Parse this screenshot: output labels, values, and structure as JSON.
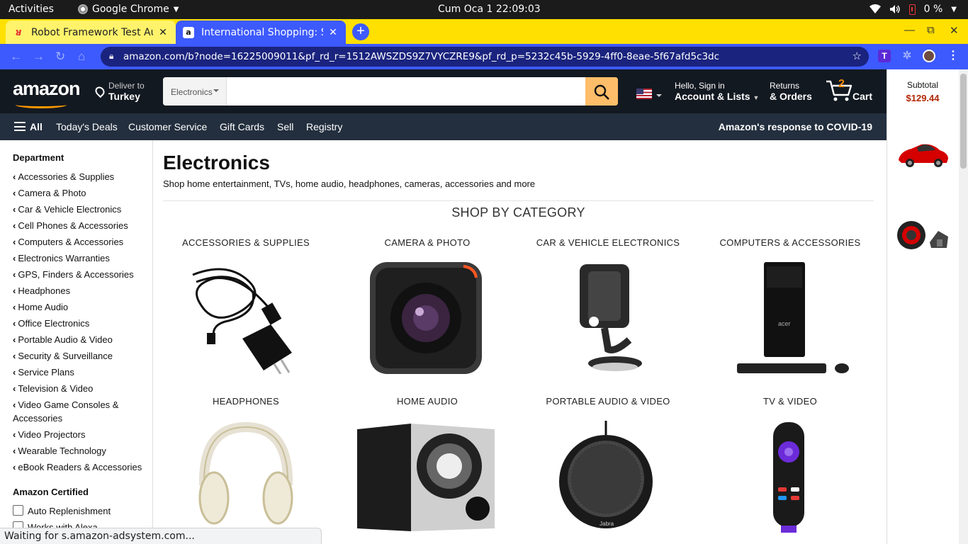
{
  "os": {
    "activities": "Activities",
    "app_name": "Google Chrome",
    "clock": "Cum Oca 1  22:09:03",
    "battery": "0 %"
  },
  "browser": {
    "tabs": [
      {
        "title": "Robot Framework Test Au",
        "active": false
      },
      {
        "title": "International Shopping: S",
        "active": true
      }
    ],
    "url": "amazon.com/b?node=16225009011&pf_rd_r=1512AWSZDS9Z7VYCZRE9&pf_rd_p=5232c45b-5929-4ff0-8eae-5f67afd5c3dc",
    "status": "Waiting for s.amazon-adsystem.com..."
  },
  "header": {
    "logo": "amazon",
    "deliver_to": "Deliver to",
    "country": "Turkey",
    "search_category": "Electronics",
    "search_placeholder": "",
    "account_line1": "Hello, Sign in",
    "account_line2": "Account & Lists",
    "returns_line1": "Returns",
    "returns_line2": "& Orders",
    "cart_count": "2",
    "cart_label": "Cart"
  },
  "subnav": {
    "all": "All",
    "items": [
      "Today's Deals",
      "Customer Service",
      "Gift Cards",
      "Sell",
      "Registry"
    ],
    "covid": "Amazon's response to COVID-19"
  },
  "sidecart": {
    "subtotal_label": "Subtotal",
    "subtotal_value": "$129.44"
  },
  "sidebar": {
    "department_title": "Department",
    "departments": [
      "Accessories & Supplies",
      "Camera & Photo",
      "Car & Vehicle Electronics",
      "Cell Phones & Accessories",
      "Computers & Accessories",
      "Electronics Warranties",
      "GPS, Finders & Accessories",
      "Headphones",
      "Home Audio",
      "Office Electronics",
      "Portable Audio & Video",
      "Security & Surveillance",
      "Service Plans",
      "Television & Video",
      "Video Game Consoles & Accessories",
      "Video Projectors",
      "Wearable Technology",
      "eBook Readers & Accessories"
    ],
    "certified_title": "Amazon Certified",
    "certified_options": [
      "Auto Replenishment",
      "Works with Alexa"
    ]
  },
  "main": {
    "title": "Electronics",
    "subtitle": "Shop home entertainment, TVs, home audio, headphones, cameras, accessories and more",
    "shop_by": "SHOP BY CATEGORY",
    "categories": [
      "ACCESSORIES & SUPPLIES",
      "CAMERA & PHOTO",
      "CAR & VEHICLE ELECTRONICS",
      "COMPUTERS & ACCESSORIES",
      "HEADPHONES",
      "HOME AUDIO",
      "PORTABLE AUDIO & VIDEO",
      "TV & VIDEO"
    ]
  },
  "colors": {
    "amazon_nav": "#131921",
    "amazon_subnav": "#232f3e",
    "amazon_orange": "#febd69",
    "chrome_theme_yellow": "#ffe000",
    "chrome_theme_blue": "#3d5afe",
    "price_red": "#b12704"
  }
}
